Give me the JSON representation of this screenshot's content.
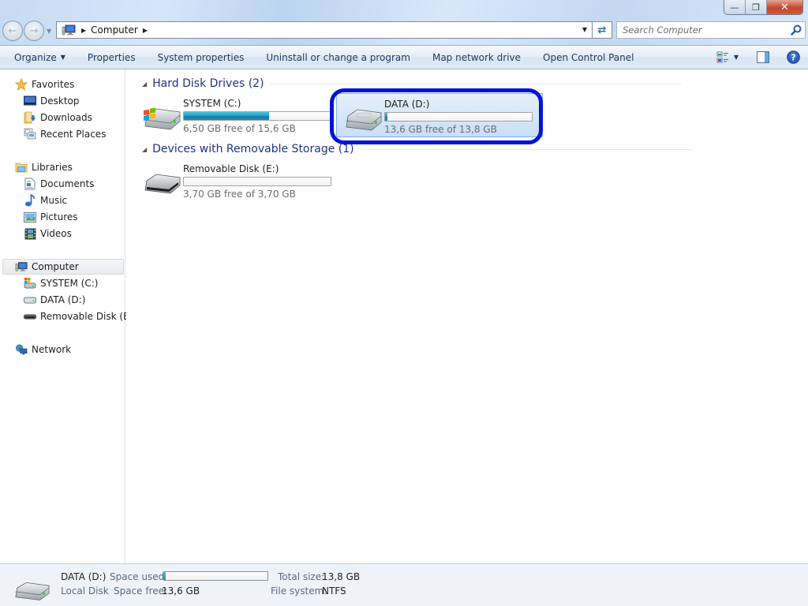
{
  "window": {
    "controls": {
      "minimize_icon": "minimize-icon",
      "restore_icon": "restore-icon",
      "close_icon": "close-icon"
    }
  },
  "navigation": {
    "back_icon": "back-arrow-icon",
    "forward_icon": "forward-arrow-icon",
    "address_path": [
      "Computer"
    ],
    "refresh_icon": "refresh-icon"
  },
  "search": {
    "placeholder": "Search Computer",
    "value": ""
  },
  "toolbar": {
    "organize": "Organize",
    "properties": "Properties",
    "system_properties": "System properties",
    "uninstall": "Uninstall or change a program",
    "map_drive": "Map network drive",
    "control_panel": "Open Control Panel"
  },
  "sidebar": {
    "favorites": {
      "label": "Favorites",
      "items": [
        {
          "label": "Desktop"
        },
        {
          "label": "Downloads"
        },
        {
          "label": "Recent Places"
        }
      ]
    },
    "libraries": {
      "label": "Libraries",
      "items": [
        {
          "label": "Documents"
        },
        {
          "label": "Music"
        },
        {
          "label": "Pictures"
        },
        {
          "label": "Videos"
        }
      ]
    },
    "computer": {
      "label": "Computer",
      "items": [
        {
          "label": "SYSTEM (C:)"
        },
        {
          "label": "DATA (D:)"
        },
        {
          "label": "Removable Disk (E:)"
        }
      ]
    },
    "network": {
      "label": "Network"
    }
  },
  "content": {
    "groups": [
      {
        "title": "Hard Disk Drives (2)",
        "drives": [
          {
            "name": "SYSTEM (C:)",
            "free_text": "6,50 GB free of 15,6 GB",
            "used_fraction": 0.583,
            "selected": false
          },
          {
            "name": "DATA (D:)",
            "free_text": "13,6 GB free of 13,8 GB",
            "used_fraction": 0.015,
            "selected": true
          }
        ]
      },
      {
        "title": "Devices with Removable Storage (1)",
        "drives": [
          {
            "name": "Removable Disk (E:)",
            "free_text": "3,70 GB free of 3,70 GB",
            "used_fraction": 0.0,
            "selected": false
          }
        ]
      }
    ]
  },
  "details": {
    "name": "DATA (D:)",
    "type": "Local Disk",
    "space_used_label": "Space used:",
    "space_used_fraction": 0.015,
    "space_free_label": "Space free:",
    "space_free_value": "13,6 GB",
    "total_size_label": "Total size:",
    "total_size_value": "13,8 GB",
    "file_system_label": "File system:",
    "file_system_value": "NTFS"
  },
  "colors": {
    "accent_bar": "#26a0c6",
    "group_header": "#1e3287",
    "highlight_ring": "#0014d8",
    "selection_bg": "#c9def5"
  }
}
